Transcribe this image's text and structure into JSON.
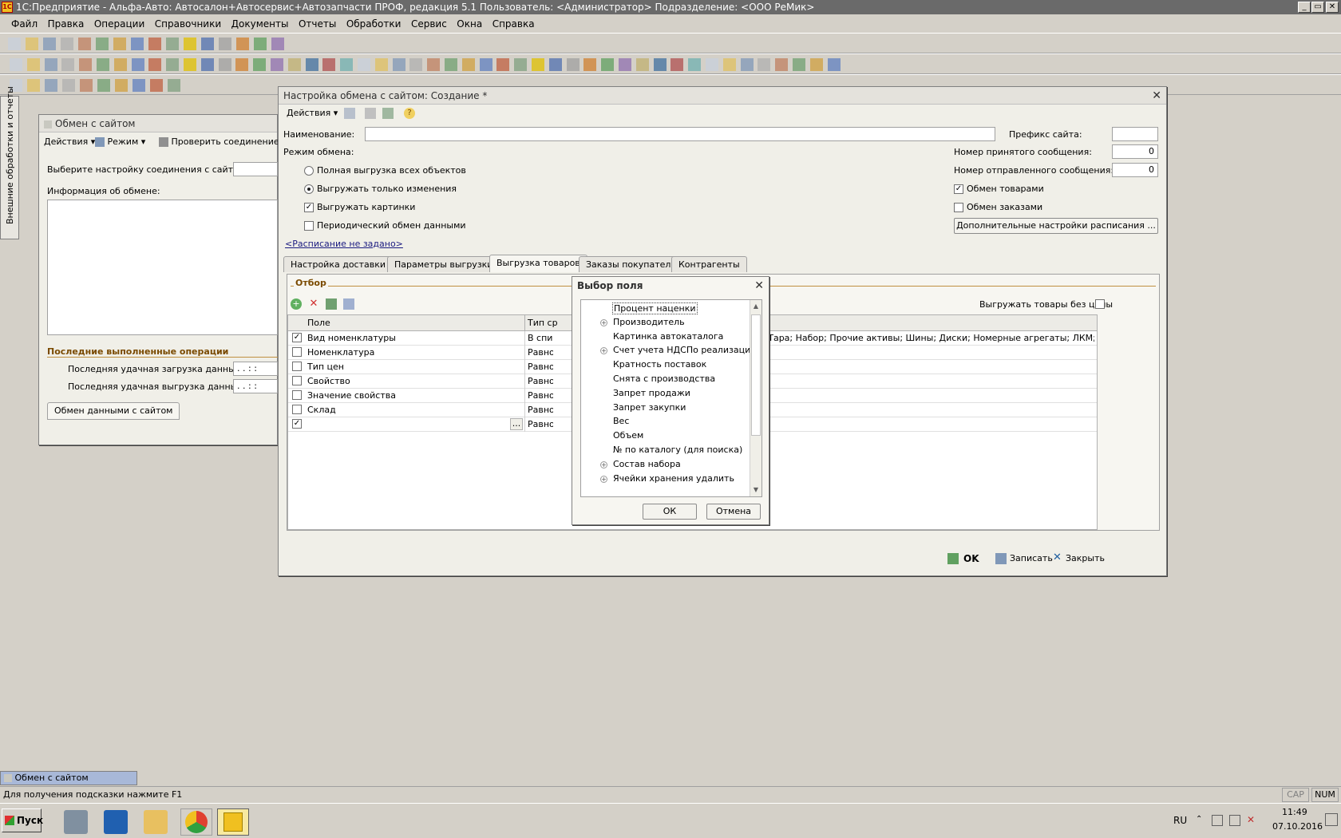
{
  "app": {
    "title": "1С:Предприятие - Альфа-Авто: Автосалон+Автосервис+Автозапчасти ПРОФ, редакция 5.1   Пользователь: <Администратор>   Подразделение: <ООО РеМик>",
    "icon_label": "1С",
    "window_buttons": {
      "minimize": "_",
      "restore": "▭",
      "close": "✕"
    }
  },
  "menu": [
    "Файл",
    "Правка",
    "Операции",
    "Справочники",
    "Документы",
    "Отчеты",
    "Обработки",
    "Сервис",
    "Окна",
    "Справка"
  ],
  "left_panel": {
    "label": "Внешние обработки и отчеты"
  },
  "back_window": {
    "title": "Обмен с сайтом",
    "toolbar": {
      "actions": "Действия",
      "mode": "Режим",
      "check": "Проверить соединение"
    },
    "select_label": "Выберите настройку соединения с сайтом:",
    "info_label": "Информация об обмене:",
    "last_ops_label": "Последние выполненные операции",
    "last_load_label": "Последняя удачная загрузка данных:",
    "last_unload_label": "Последняя удачная выгрузка данных:",
    "date_placeholder": " .  .    :  :",
    "bottom_tab": "Обмен данными с сайтом"
  },
  "main_window": {
    "title": "Настройка обмена с сайтом: Создание *",
    "toolbar": {
      "actions": "Действия"
    },
    "name_label": "Наименование:",
    "name_value": "",
    "prefix_label": "Префикс сайта:",
    "prefix_value": "",
    "mode_label": "Режим обмена:",
    "received_label": "Номер принятого сообщения:",
    "received_value": "0",
    "sent_label": "Номер отправленного сообщения:",
    "sent_value": "0",
    "options": {
      "full": "Полная выгрузка всех объектов",
      "changes": "Выгружать только изменения",
      "pictures": "Выгружать картинки",
      "periodic": "Периодический обмен данными"
    },
    "goods_exchange": "Обмен товарами",
    "orders_exchange": "Обмен заказами",
    "schedule_button": "Дополнительные настройки расписания ...",
    "schedule_link": "<Расписание не задано>",
    "tabs": [
      "Настройка доставки",
      "Параметры выгрузки",
      "Выгрузка товаров",
      "Заказы покупателя",
      "Контрагенты"
    ],
    "filter_label": "Отбор",
    "no_price_label": "Выгружать товары без цены",
    "grid": {
      "headers": {
        "field": "Поле",
        "type": "Тип ср"
      },
      "rows": [
        {
          "checked": true,
          "field": "Вид номенклатуры",
          "type": "В спис",
          "value": "плект; Тара; Набор; Прочие активы; Шины; Диски; Номерные агрегаты; ЛКМ;..."
        },
        {
          "checked": false,
          "field": "Номенклатура",
          "type": "Равно",
          "value": ""
        },
        {
          "checked": false,
          "field": "Тип цен",
          "type": "Равно",
          "value": ""
        },
        {
          "checked": false,
          "field": "Свойство",
          "type": "Равно",
          "value": ""
        },
        {
          "checked": false,
          "field": "Значение свойства",
          "type": "Равно",
          "value": ""
        },
        {
          "checked": false,
          "field": "Склад",
          "type": "Равно",
          "value": ""
        },
        {
          "checked": true,
          "field": "",
          "type": "Равно",
          "value": "",
          "ellipsis": "..."
        }
      ]
    },
    "footer": {
      "ok": "OK",
      "save": "Записать",
      "close": "Закрыть"
    }
  },
  "dialog": {
    "title": "Выбор поля",
    "items": [
      {
        "label": "Процент наценки",
        "expandable": false
      },
      {
        "label": "Производитель",
        "expandable": true
      },
      {
        "label": "Картинка автокаталога",
        "expandable": false
      },
      {
        "label": "Счет учета НДСПо реализации",
        "expandable": true
      },
      {
        "label": "Кратность поставок",
        "expandable": false
      },
      {
        "label": "Снята с производства",
        "expandable": false
      },
      {
        "label": "Запрет продажи",
        "expandable": false
      },
      {
        "label": "Запрет закупки",
        "expandable": false
      },
      {
        "label": "Вес",
        "expandable": false
      },
      {
        "label": "Объем",
        "expandable": false
      },
      {
        "label": "№ по каталогу (для поиска)",
        "expandable": false
      },
      {
        "label": "Состав набора",
        "expandable": true
      },
      {
        "label": "Ячейки хранения удалить",
        "expandable": true
      }
    ],
    "ok": "ОК",
    "cancel": "Отмена"
  },
  "window_list": {
    "item": "Обмен с сайтом"
  },
  "status": {
    "hint": "Для получения подсказки нажмите F1",
    "cap": "CAP",
    "num": "NUM"
  },
  "taskbar": {
    "start": "Пуск",
    "lang": "RU",
    "time": "11:49",
    "date": "07.10.2016"
  },
  "colors": {
    "accent": "#f0c020",
    "window_bg": "#f0efe8",
    "taskbar_active": "#f7e9a0"
  }
}
